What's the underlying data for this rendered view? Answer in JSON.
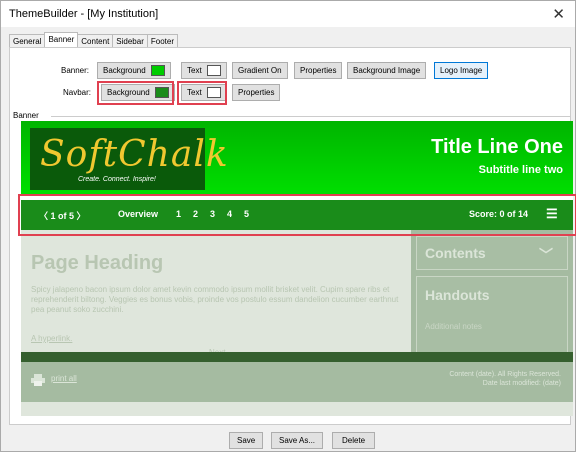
{
  "window": {
    "title": "ThemeBuilder - [My Institution]",
    "close_glyph": "✕"
  },
  "tabs": [
    "General",
    "Banner",
    "Content",
    "Sidebar",
    "Footer"
  ],
  "banner_row": {
    "label": "Banner:",
    "background_label": "Background",
    "background_color": "#00cc00",
    "text_label": "Text",
    "text_color": "#ffffff",
    "gradient_label": "Gradient On",
    "properties_label": "Properties",
    "bg_image_label": "Background Image",
    "logo_image_label": "Logo Image"
  },
  "navbar_row": {
    "label": "Navbar:",
    "background_label": "Background",
    "background_color": "#1a8c1a",
    "text_label": "Text",
    "text_color": "#ffffff",
    "properties_label": "Properties"
  },
  "group_label": "Banner",
  "preview": {
    "logo_text": "SoftChalk",
    "logo_tagline": "Create. Connect. Inspire!",
    "title_line_one": "Title Line One",
    "subtitle": "Subtitle line two",
    "nav": {
      "pager": "〈 1 of 5 〉",
      "overview": "Overview",
      "pages": [
        "1",
        "2",
        "3",
        "4",
        "5"
      ],
      "score": "Score: 0 of 14",
      "menu_glyph": "☰"
    },
    "page_heading": "Page Heading",
    "lorem": "Spicy jalapeno bacon ipsum dolor amet kevin commodo ipsum mollit brisket velit. Cupim spare ribs et reprehenderit biltong. Veggies es bonus vobis, proinde vos postulo essum dandelion cucumber earthnut pea peanut soko zucchini.",
    "hyperlink": "A hyperlink.",
    "next": "Next",
    "contents_label": "Contents",
    "contents_glyph": "﹀",
    "handouts_label": "Handouts",
    "additional_notes": "Additional notes",
    "print_label": "print all",
    "copyright_line1": "Content (date). All Rights Reserved.",
    "copyright_line2": "Date last modified: (date)"
  },
  "footer_buttons": {
    "save": "Save",
    "save_as": "Save As...",
    "delete": "Delete"
  }
}
